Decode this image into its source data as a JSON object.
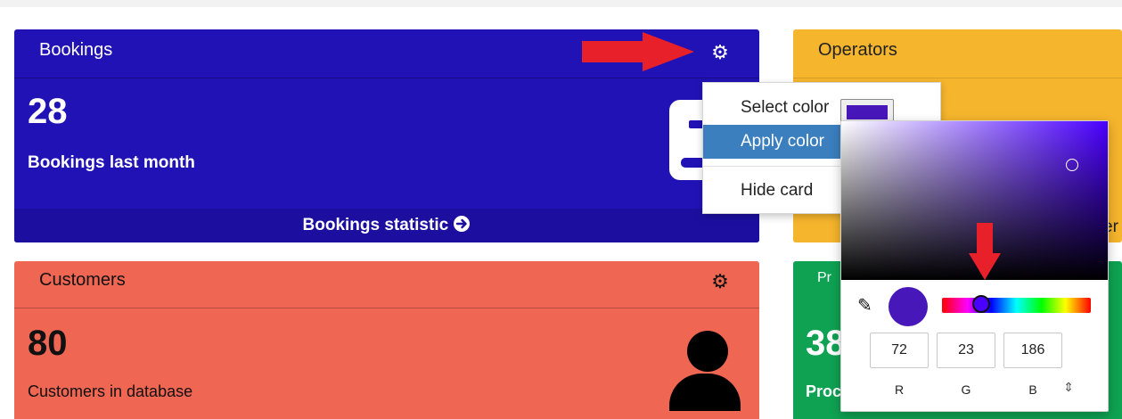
{
  "colors": {
    "bookings_bg": "#2112b5",
    "bookings_footer": "#1c0fa0",
    "operators_bg": "#f5b52d",
    "customers_bg": "#ef6652",
    "products_bg": "#0fa252",
    "menu_highlight": "#3b7fbf",
    "selected_color": "#4817ba",
    "picker_hue": "#4a00ff",
    "arrow_red": "#e8202a"
  },
  "cards": {
    "bookings": {
      "title": "Bookings",
      "value": "28",
      "subtitle": "Bookings last month",
      "footer": "Bookings statistic",
      "footer_icon": "arrow-circle-right-icon",
      "settings_icon": "gear-icon",
      "illustration_icon": "document-icon"
    },
    "operators": {
      "title": "Operators",
      "footer_fragment": "er"
    },
    "customers": {
      "title": "Customers",
      "value": "80",
      "subtitle": "Customers in database",
      "settings_icon": "gear-icon",
      "illustration_icon": "person-icon"
    },
    "products": {
      "title": "Pr",
      "value": "38",
      "subtitle": "Proc"
    }
  },
  "context_menu": {
    "select_color_label": "Select color",
    "apply_color_label": "Apply color",
    "hide_card_label": "Hide card"
  },
  "color_picker": {
    "r_value": "72",
    "g_value": "23",
    "b_value": "186",
    "r_label": "R",
    "g_label": "G",
    "b_label": "B",
    "eyedropper_icon": "eyedropper-icon",
    "mode_toggle_icon": "up-down-arrows-icon"
  },
  "icons": {
    "gear": "⚙",
    "arrow_circle": "➔",
    "eyedropper": "✎",
    "updown": "⇕"
  }
}
